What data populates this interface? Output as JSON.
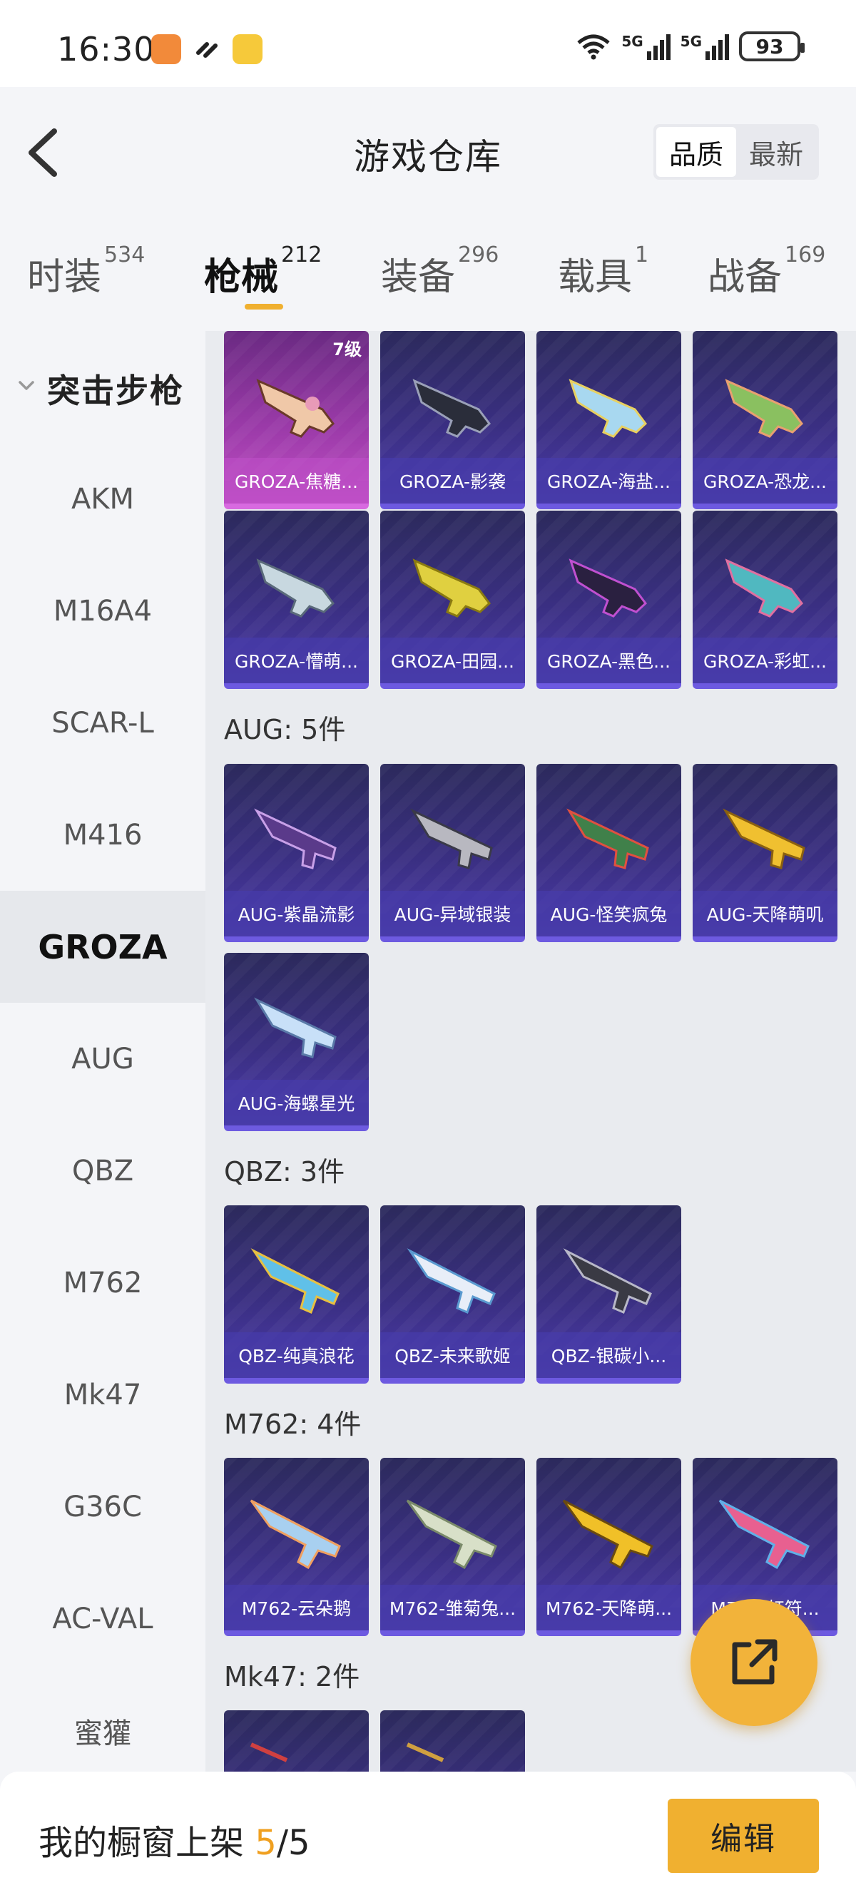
{
  "status_bar": {
    "time": "16:30",
    "signal1": "5G",
    "signal2": "5G",
    "battery": "93"
  },
  "header": {
    "title": "游戏仓库",
    "sort_options": [
      "品质",
      "最新"
    ],
    "sort_active": "品质"
  },
  "tabs": [
    {
      "label": "时装",
      "count": "534"
    },
    {
      "label": "枪械",
      "count": "212"
    },
    {
      "label": "装备",
      "count": "296"
    },
    {
      "label": "载具",
      "count": "1"
    },
    {
      "label": "战备",
      "count": "169"
    }
  ],
  "active_tab": "枪械",
  "sidebar": {
    "category": "突击步枪",
    "items": [
      "AKM",
      "M16A4",
      "SCAR-L",
      "M416",
      "GROZA",
      "AUG",
      "QBZ",
      "M762",
      "Mk47",
      "G36C",
      "AC-VAL",
      "蜜獾"
    ],
    "active": "GROZA"
  },
  "groups": [
    {
      "title": "",
      "items": [
        {
          "name": "GROZA-焦糖...",
          "badge": "7级",
          "rarity": "pink"
        },
        {
          "name": "GROZA-影袭",
          "rarity": "purple"
        },
        {
          "name": "GROZA-海盐...",
          "rarity": "purple"
        },
        {
          "name": "GROZA-恐龙...",
          "rarity": "purple"
        },
        {
          "name": "GROZA-懵萌...",
          "rarity": "purple"
        },
        {
          "name": "GROZA-田园...",
          "rarity": "purple"
        },
        {
          "name": "GROZA-黑色...",
          "rarity": "purple"
        },
        {
          "name": "GROZA-彩虹...",
          "rarity": "purple"
        }
      ]
    },
    {
      "title": "AUG: 5件",
      "items": [
        {
          "name": "AUG-紫晶流影",
          "rarity": "purple"
        },
        {
          "name": "AUG-异域银装",
          "rarity": "purple"
        },
        {
          "name": "AUG-怪笑疯兔",
          "rarity": "purple"
        },
        {
          "name": "AUG-天降萌叽",
          "rarity": "purple"
        },
        {
          "name": "AUG-海螺星光",
          "rarity": "purple"
        }
      ]
    },
    {
      "title": "QBZ: 3件",
      "items": [
        {
          "name": "QBZ-纯真浪花",
          "rarity": "purple"
        },
        {
          "name": "QBZ-未来歌姬",
          "rarity": "purple"
        },
        {
          "name": "QBZ-银碳小...",
          "rarity": "purple"
        }
      ]
    },
    {
      "title": "M762: 4件",
      "items": [
        {
          "name": "M762-云朵鹅",
          "rarity": "purple"
        },
        {
          "name": "M762-雏菊兔...",
          "rarity": "purple"
        },
        {
          "name": "M762-天降萌...",
          "rarity": "purple"
        },
        {
          "name": "M762-虹符...",
          "rarity": "purple"
        }
      ]
    },
    {
      "title": "Mk47: 2件",
      "items": [
        {
          "name": "",
          "rarity": "purple"
        },
        {
          "name": "",
          "rarity": "purple"
        }
      ]
    }
  ],
  "bottom_bar": {
    "label": "我的橱窗上架",
    "shelved": "5",
    "total": "/5",
    "button": "编辑"
  },
  "colors": {
    "accent": "#f0b030",
    "card_purple": "#3a2f82",
    "card_pink": "#9a3aa8"
  },
  "icons": {
    "back": "chevron-left-icon",
    "fab": "share-external-icon",
    "collapse": "chevron-down-icon"
  }
}
